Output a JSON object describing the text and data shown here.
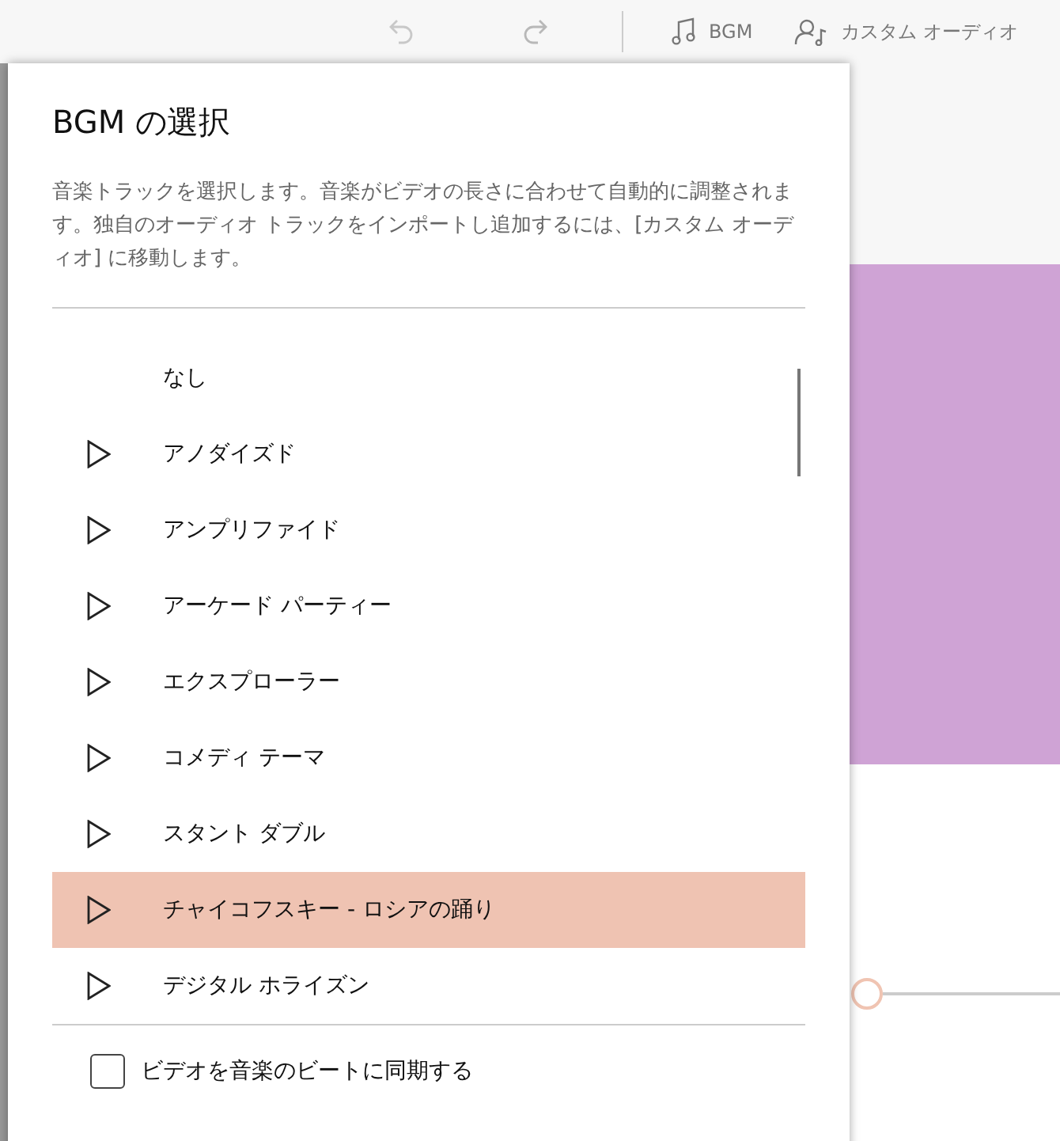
{
  "toolbar": {
    "buttons": [
      {
        "kind": "music",
        "label": "BGM"
      },
      {
        "kind": "person",
        "label": "カスタム オーディオ"
      }
    ]
  },
  "dialog": {
    "title": "BGM の選択",
    "description": "音楽トラックを選択します。音楽がビデオの長さに合わせて自動的に調整されます。独自のオーディオ トラックをインポートし追加するには、[カスタム オーディオ] に移動します。",
    "tracks": [
      {
        "kind": "none",
        "label": "なし",
        "selected": false
      },
      {
        "kind": "track",
        "label": "アノダイズド",
        "selected": false
      },
      {
        "kind": "track",
        "label": "アンプリファイド",
        "selected": false
      },
      {
        "kind": "track",
        "label": "アーケード パーティー",
        "selected": false
      },
      {
        "kind": "track",
        "label": "エクスプローラー",
        "selected": false
      },
      {
        "kind": "track",
        "label": "コメディ テーマ",
        "selected": false
      },
      {
        "kind": "track",
        "label": "スタント ダブル",
        "selected": false
      },
      {
        "kind": "track",
        "label": "チャイコフスキー - ロシアの踊り",
        "selected": true
      },
      {
        "kind": "track",
        "label": "デジタル ホライズン",
        "selected": false
      }
    ],
    "sync": {
      "label": "ビデオを音楽のビートに同期する",
      "checked": false
    }
  }
}
